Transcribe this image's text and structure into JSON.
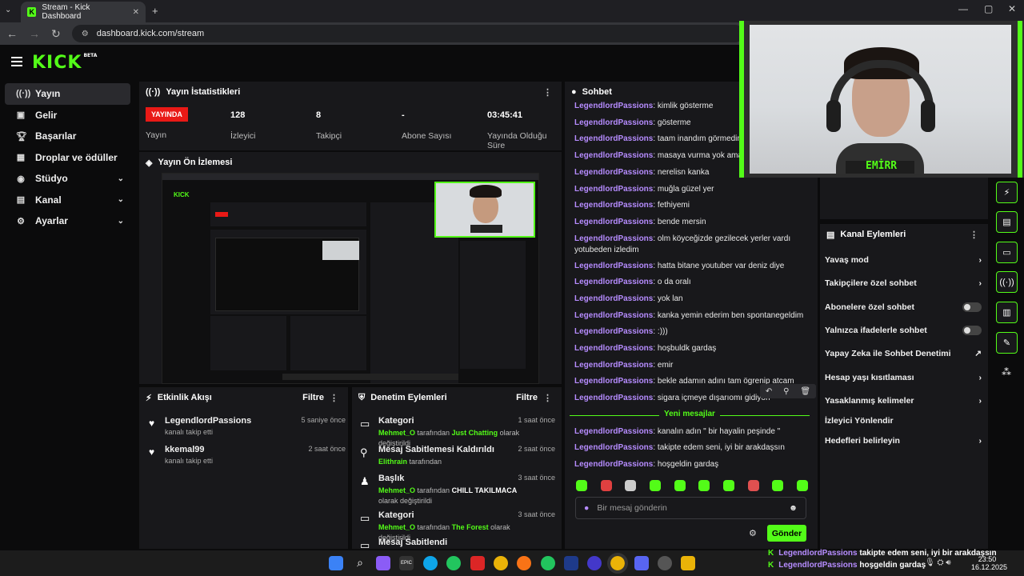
{
  "browser": {
    "tab_title": "Stream - Kick Dashboard",
    "url": "dashboard.kick.com/stream"
  },
  "brand": {
    "logo": "KICK",
    "beta": "BETA",
    "accent": "#53fc18"
  },
  "sidebar": {
    "items": [
      {
        "label": "Yayın",
        "icon": "broadcast-icon"
      },
      {
        "label": "Gelir",
        "icon": "revenue-icon"
      },
      {
        "label": "Başarılar",
        "icon": "trophy-icon"
      },
      {
        "label": "Droplar ve ödüller",
        "icon": "gift-icon"
      },
      {
        "label": "Stüdyo",
        "icon": "studio-icon"
      },
      {
        "label": "Kanal",
        "icon": "channel-icon"
      },
      {
        "label": "Ayarlar",
        "icon": "gear-icon"
      }
    ]
  },
  "stats": {
    "title": "Yayın İstatistikleri",
    "live_badge": "YAYINDA",
    "live_label": "Yayın",
    "viewers_value": "128",
    "viewers_label": "İzleyici",
    "followers_value": "8",
    "followers_label": "Takipçi",
    "subs_value": "-",
    "subs_label": "Abone Sayısı",
    "uptime_value": "03:45:41",
    "uptime_label": "Yayında Olduğu Süre"
  },
  "preview": {
    "title": "Yayın Ön İzlemesi"
  },
  "activity": {
    "title": "Etkinlik Akışı",
    "filter": "Filtre",
    "items": [
      {
        "name": "LegendlordPassions",
        "sub": "kanalı takip etti",
        "time": "5 saniye önce"
      },
      {
        "name": "kkemal99",
        "sub": "kanalı takip etti",
        "time": "2 saat önce"
      }
    ]
  },
  "moderation": {
    "title": "Denetim Eylemleri",
    "filter": "Filtre",
    "items": [
      {
        "title": "Kategori",
        "user": "Mehmet_O",
        "mid": "tarafından",
        "value": "Just Chatting",
        "end": "olarak değiştirildi",
        "time": "1 saat önce",
        "icon": "category-icon"
      },
      {
        "title": "Mesaj Sabitlemesi Kaldırıldı",
        "user": "Elithrain",
        "mid": "tarafından",
        "value": "",
        "end": "",
        "time": "2 saat önce",
        "icon": "unpin-icon"
      },
      {
        "title": "Başlık",
        "user": "Mehmet_O",
        "mid": "tarafından",
        "value": "CHILL TAKILMACA",
        "end": "olarak değiştirildi",
        "time": "3 saat önce",
        "icon": "title-icon"
      },
      {
        "title": "Kategori",
        "user": "Mehmet_O",
        "mid": "tarafından",
        "value": "The Forest",
        "end": "olarak değiştirildi",
        "time": "3 saat önce",
        "icon": "category-icon"
      },
      {
        "title": "Mesaj Sabitlendi",
        "user": "",
        "mid": "",
        "value": "",
        "end": "",
        "time": "",
        "icon": "pin-icon"
      }
    ]
  },
  "chat": {
    "title": "Sohbet",
    "messages": [
      {
        "user": "LegendlordPassions",
        "text": ": kimlik gösterme"
      },
      {
        "user": "LegendlordPassions",
        "text": ": gösterme"
      },
      {
        "user": "LegendlordPassions",
        "text": ": taam inandım görmedim am"
      },
      {
        "user": "LegendlordPassions",
        "text": ": masaya vurma yok ama söy"
      },
      {
        "user": "LegendlordPassions",
        "text": ": nerelisn kanka"
      },
      {
        "user": "LegendlordPassions",
        "text": ": muğla güzel yer"
      },
      {
        "user": "LegendlordPassions",
        "text": ": fethiyemi"
      },
      {
        "user": "LegendlordPassions",
        "text": ": bende mersin"
      },
      {
        "user": "LegendlordPassions",
        "text": ": olm köyceğizde gezilecek yerler vardı yotubeden izledim"
      },
      {
        "user": "LegendlordPassions",
        "text": ": hatta bitane youtuber var deniz diye"
      },
      {
        "user": "LegendlordPassions",
        "text": ": o da oralı"
      },
      {
        "user": "LegendlordPassions",
        "text": ": yok lan"
      },
      {
        "user": "LegendlordPassions",
        "text": ": kanka yemin ederim ben spontanegeldim"
      },
      {
        "user": "LegendlordPassions",
        "text": ": :)))"
      },
      {
        "user": "LegendlordPassions",
        "text": ": hoşbuldk gardaş"
      },
      {
        "user": "LegendlordPassions",
        "text": ": emir"
      },
      {
        "user": "LegendlordPassions",
        "text": ": bekle adamın adını tam ögrenip atcam"
      },
      {
        "user": "LegendlordPassions",
        "text": ": sigara içmeye dışarıomı gidiyon"
      }
    ],
    "new_label": "Yeni mesajlar",
    "new_messages": [
      {
        "user": "LegendlordPassions",
        "text": ": kanalın adın \" bir hayalin peşinde \""
      },
      {
        "user": "LegendlordPassions",
        "text": ": takipte edem seni, iyi bir arakdaşsın"
      },
      {
        "user": "LegendlordPassions",
        "text": ": hoşgeldin gardaş"
      }
    ],
    "placeholder": "Bir mesaj gönderin",
    "send": "Gönder"
  },
  "channel_actions": {
    "title": "Kanal Eylemleri",
    "items": [
      {
        "label": "Yavaş mod",
        "control": "chevron"
      },
      {
        "label": "Takipçilere özel sohbet",
        "control": "chevron"
      },
      {
        "label": "Abonelere özel sohbet",
        "control": "toggle"
      },
      {
        "label": "Yalnızca ifadelerle sohbet",
        "control": "toggle"
      },
      {
        "label": "Yapay Zeka ile Sohbet Denetimi",
        "control": "external"
      },
      {
        "label": "Hesap yaşı kısıtlaması",
        "control": "chevron"
      },
      {
        "label": "Yasaklanmış kelimeler",
        "control": "chevron"
      },
      {
        "label": "İzleyici Yönlendir",
        "control": "none"
      },
      {
        "label": "Hedefleri belirleyin",
        "control": "chevron"
      }
    ]
  },
  "webcam": {
    "label": "EMİRR"
  },
  "taskbar": {
    "time": "23:50",
    "date": "16.12.2025"
  },
  "toasts": [
    {
      "user": "LegendlordPassions",
      "text": "takipte edem seni, iyi bir arakdaşsın"
    },
    {
      "user": "LegendlordPassions",
      "text": "hoşgeldin gardaş"
    }
  ]
}
